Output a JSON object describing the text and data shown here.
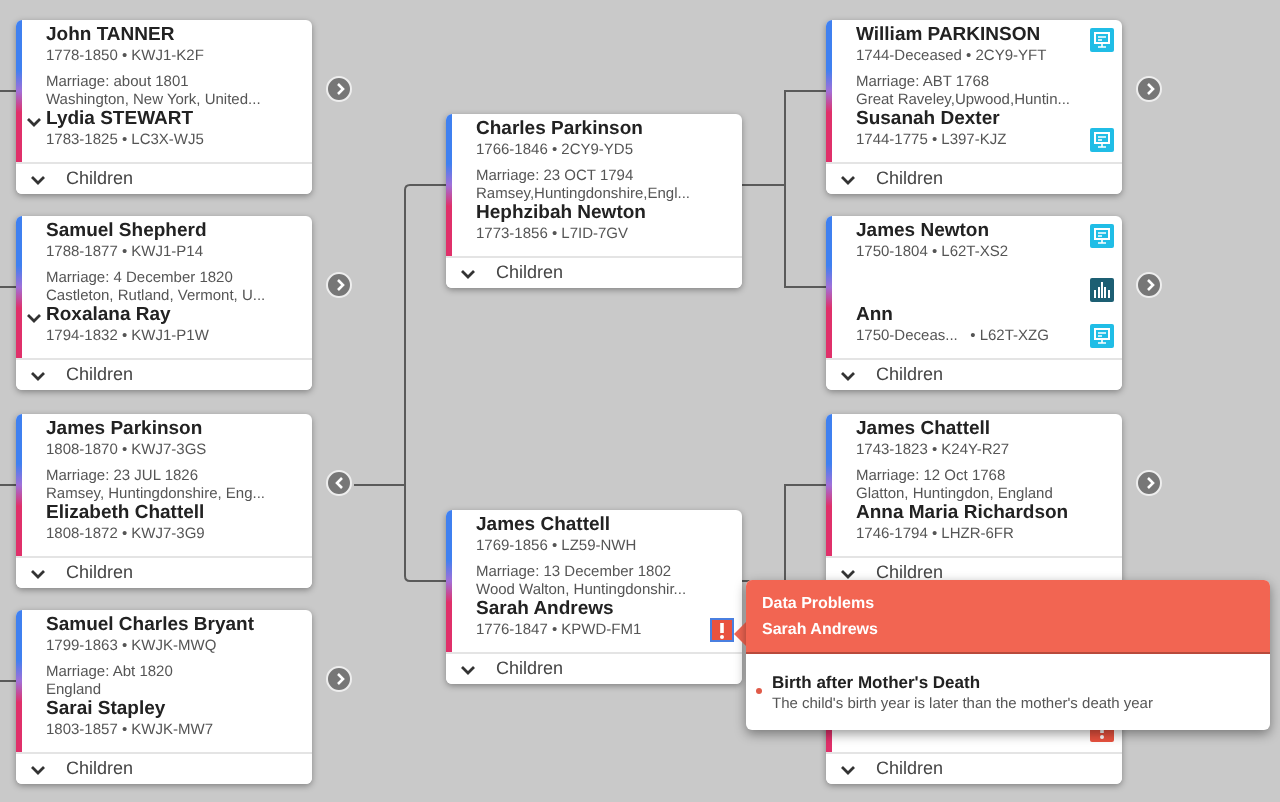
{
  "columns": [
    {
      "cards": [
        {
          "father": {
            "name": "John TANNER",
            "details": "1778-1850 • KWJ1-K2F"
          },
          "marriage": {
            "date": "Marriage: about 1801",
            "place": "Washington, New York, United..."
          },
          "spouse_toggle": true,
          "mother": {
            "name": "Lydia STEWART",
            "details": "1783-1825 • LC3X-WJ5"
          },
          "children": "Children",
          "expand_right": true,
          "expand_left": false
        },
        {
          "father": {
            "name": "Samuel Shepherd",
            "details": "1788-1877 • KWJ1-P14"
          },
          "marriage": {
            "date": "Marriage: 4 December 1820",
            "place": "Castleton, Rutland, Vermont, U..."
          },
          "spouse_toggle": true,
          "mother": {
            "name": "Roxalana Ray",
            "details": "1794-1832 • KWJ1-P1W"
          },
          "children": "Children",
          "expand_right": true,
          "expand_left": false
        },
        {
          "father": {
            "name": "James Parkinson",
            "details": "1808-1870 • KWJ7-3GS"
          },
          "marriage": {
            "date": "Marriage: 23 JUL 1826",
            "place": "Ramsey, Huntingdonshire, Eng..."
          },
          "spouse_toggle": false,
          "mother": {
            "name": "Elizabeth Chattell",
            "details": "1808-1872 • KWJ7-3G9"
          },
          "children": "Children",
          "expand_right": false,
          "expand_left": true
        },
        {
          "father": {
            "name": "Samuel Charles Bryant",
            "details": "1799-1863 • KWJK-MWQ"
          },
          "marriage": {
            "date": "Marriage: Abt 1820",
            "place": "England"
          },
          "spouse_toggle": false,
          "mother": {
            "name": "Sarai Stapley",
            "details": "1803-1857 • KWJK-MW7"
          },
          "children": "Children",
          "expand_right": true,
          "expand_left": false
        }
      ]
    },
    {
      "cards": [
        {
          "father": {
            "name": "Charles Parkinson",
            "details": "1766-1846 • 2CY9-YD5"
          },
          "marriage": {
            "date": "Marriage: 23 OCT 1794",
            "place": "Ramsey,Huntingdonshire,Engl..."
          },
          "spouse_toggle": false,
          "mother": {
            "name": "Hephzibah Newton",
            "details": "1773-1856 • L7ID-7GV"
          },
          "children": "Children"
        },
        {
          "father": {
            "name": "James Chattell",
            "details": "1769-1856 • LZ59-NWH"
          },
          "marriage": {
            "date": "Marriage: 13 December 1802",
            "place": "Wood Walton, Huntingdonshir..."
          },
          "spouse_toggle": false,
          "mother": {
            "name": "Sarah Andrews",
            "details": "1776-1847 • KPWD-FM1",
            "badge": {
              "kind": "problem",
              "selected": true
            }
          },
          "children": "Children"
        }
      ]
    },
    {
      "cards": [
        {
          "father": {
            "name": "William PARKINSON",
            "details": "1744-Deceased • 2CY9-YFT",
            "badge": {
              "kind": "hint",
              "selected": false
            }
          },
          "marriage": {
            "date": "Marriage: ABT 1768",
            "place": "Great Raveley,Upwood,Huntin..."
          },
          "spouse_toggle": false,
          "mother": {
            "name": "Susanah Dexter",
            "details": "1744-1775 • L397-KJZ",
            "badge": {
              "kind": "hint",
              "selected": false
            }
          },
          "children": "Children",
          "expand_right": true,
          "expand_left": false
        },
        {
          "father": {
            "name": "James Newton",
            "details": "1750-1804 • L62T-XS2",
            "badge": {
              "kind": "hint",
              "selected": false
            }
          },
          "temple_icon": true,
          "spouse_toggle": false,
          "mother": {
            "name": "Ann",
            "details": "1750-Deceas...   • L62T-XZG",
            "badge": {
              "kind": "hint",
              "selected": false
            }
          },
          "children": "Children",
          "expand_right": true,
          "expand_left": false
        },
        {
          "father": {
            "name": "James Chattell",
            "details": "1743-1823 • K24Y-R27"
          },
          "marriage": {
            "date": "Marriage: 12 Oct 1768",
            "place": "Glatton, Huntingdon, England"
          },
          "spouse_toggle": false,
          "mother": {
            "name": "Anna Maria Richardson",
            "details": "1746-1794 • LHZR-6FR"
          },
          "children": "Children",
          "expand_right": true,
          "expand_left": false
        },
        {
          "mother": {
            "badge": {
              "kind": "problem",
              "selected": false
            }
          },
          "children": "Children"
        }
      ]
    }
  ],
  "problems": {
    "title": "Data Problems",
    "person": "Sarah Andrews",
    "items": [
      {
        "title": "Birth after Mother's Death",
        "description": "The child's birth year is later than the mother's death year"
      }
    ]
  }
}
